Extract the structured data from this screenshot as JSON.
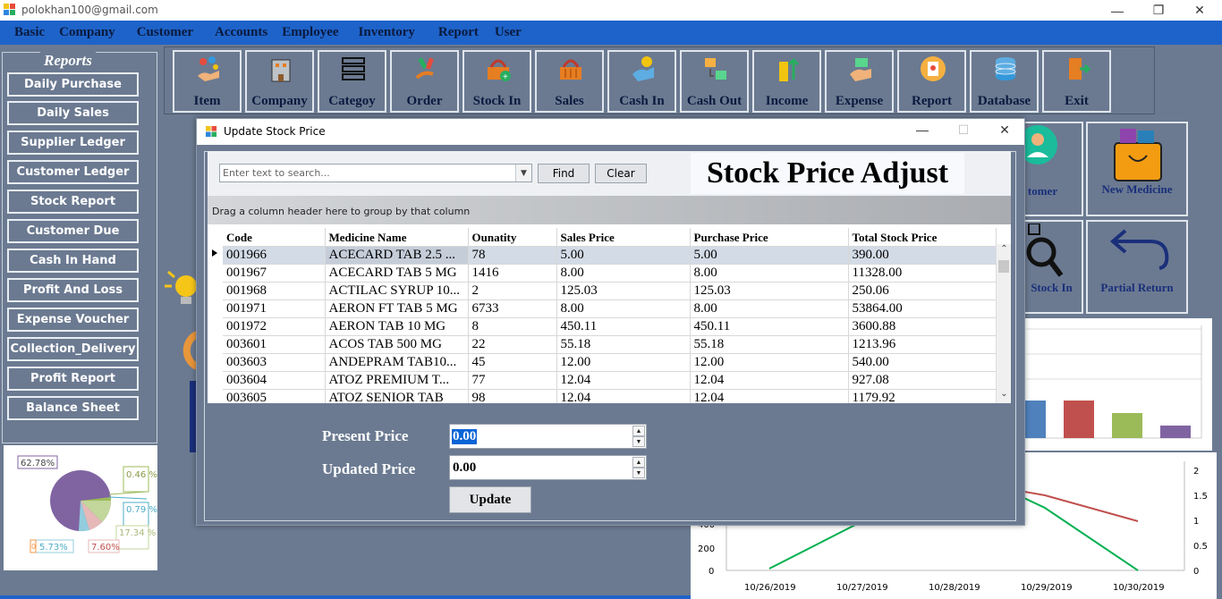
{
  "window": {
    "title": "polokhan100@gmail.com"
  },
  "menu": [
    "Basic",
    "Company",
    "Customer",
    "Accounts",
    "Employee",
    "Inventory",
    "Report",
    "User"
  ],
  "reports": {
    "legend": "Reports",
    "items": [
      "Daily Purchase",
      "Daily Sales",
      "Supplier Ledger",
      "Customer Ledger",
      "Stock Report",
      "Customer Due",
      "Cash In Hand",
      "Profit And Loss",
      "Expense Voucher",
      "Collection_Delivery",
      "Profit Report",
      "Balance Sheet"
    ]
  },
  "toolbar": [
    {
      "label": "Item",
      "icon": "hand-pills-icon"
    },
    {
      "label": "Company",
      "icon": "building-icon"
    },
    {
      "label": "Categoy",
      "icon": "list-icon"
    },
    {
      "label": "Order",
      "icon": "medicine-order-icon"
    },
    {
      "label": "Stock In",
      "icon": "basket-add-icon"
    },
    {
      "label": "Sales",
      "icon": "basket-icon"
    },
    {
      "label": "Cash In",
      "icon": "cash-in-icon"
    },
    {
      "label": "Cash Out",
      "icon": "cash-out-icon"
    },
    {
      "label": "Income",
      "icon": "coins-up-icon"
    },
    {
      "label": "Expense",
      "icon": "expense-icon"
    },
    {
      "label": "Report",
      "icon": "report-icon"
    },
    {
      "label": "Database",
      "icon": "database-icon"
    },
    {
      "label": "Exit",
      "icon": "exit-door-icon"
    }
  ],
  "side_tiles": {
    "customer_partial": "tomer",
    "new_medicine": "New Medicine",
    "stock_in_partial": "Stock In",
    "partial_return": "Partial Return"
  },
  "pie": {
    "labels": [
      "62.78%",
      "0.46 %",
      "0.79 %",
      "17.34 %",
      "7.60%",
      "5.73%",
      "0"
    ],
    "colors": [
      "#8064a2",
      "#9bbb59",
      "#4bacc6",
      "#c3d69b",
      "#e6b9b8",
      "#93cddd",
      "#f79646"
    ]
  },
  "bar_chart": {
    "colors": [
      "#4f81bd",
      "#c0504d",
      "#9bbb59",
      "#8064a2"
    ]
  },
  "line_chart": {
    "x_labels": [
      "10/26/2019",
      "10/27/2019",
      "10/28/2019",
      "10/29/2019",
      "10/30/2019"
    ],
    "left_ticks": [
      "0",
      "200",
      "400"
    ],
    "right_ticks": [
      "0",
      "0.5",
      "1",
      "1.5",
      "2"
    ]
  },
  "dialog": {
    "title": "Update Stock Price",
    "search_placeholder": "Enter text to search...",
    "find_label": "Find",
    "clear_label": "Clear",
    "heading": "Stock Price Adjust",
    "group_hint": "Drag a column header here to group by that column",
    "columns": [
      "Code",
      "Medicine Name",
      "Ounatity",
      "Sales Price",
      "Purchase Price",
      "Total Stock Price"
    ],
    "rows": [
      [
        "001966",
        "ACECARD TAB 2.5 ...",
        "78",
        "5.00",
        "5.00",
        "390.00"
      ],
      [
        "001967",
        "ACECARD TAB 5 MG",
        "1416",
        "8.00",
        "8.00",
        "11328.00"
      ],
      [
        "001968",
        "ACTILAC SYRUP 10...",
        "2",
        "125.03",
        "125.03",
        "250.06"
      ],
      [
        "001971",
        "AERON FT TAB 5 MG",
        "6733",
        "8.00",
        "8.00",
        "53864.00"
      ],
      [
        "001972",
        "AERON TAB 10 MG",
        "8",
        "450.11",
        "450.11",
        "3600.88"
      ],
      [
        "003601",
        "ACOS TAB 500 MG",
        "22",
        "55.18",
        "55.18",
        "1213.96"
      ],
      [
        "003603",
        "ANDEPRAM TAB10...",
        "45",
        "12.00",
        "12.00",
        "540.00"
      ],
      [
        "003604",
        "ATOZ PREMIUM T...",
        "77",
        "12.04",
        "12.04",
        "927.08"
      ],
      [
        "003605",
        "ATOZ SENIOR TAB",
        "98",
        "12.04",
        "12.04",
        "1179.92"
      ]
    ],
    "present_price_label": "Present Price",
    "present_price_value": "0.00",
    "updated_price_label": "Updated Price",
    "updated_price_value": "0.00",
    "update_label": "Update"
  }
}
